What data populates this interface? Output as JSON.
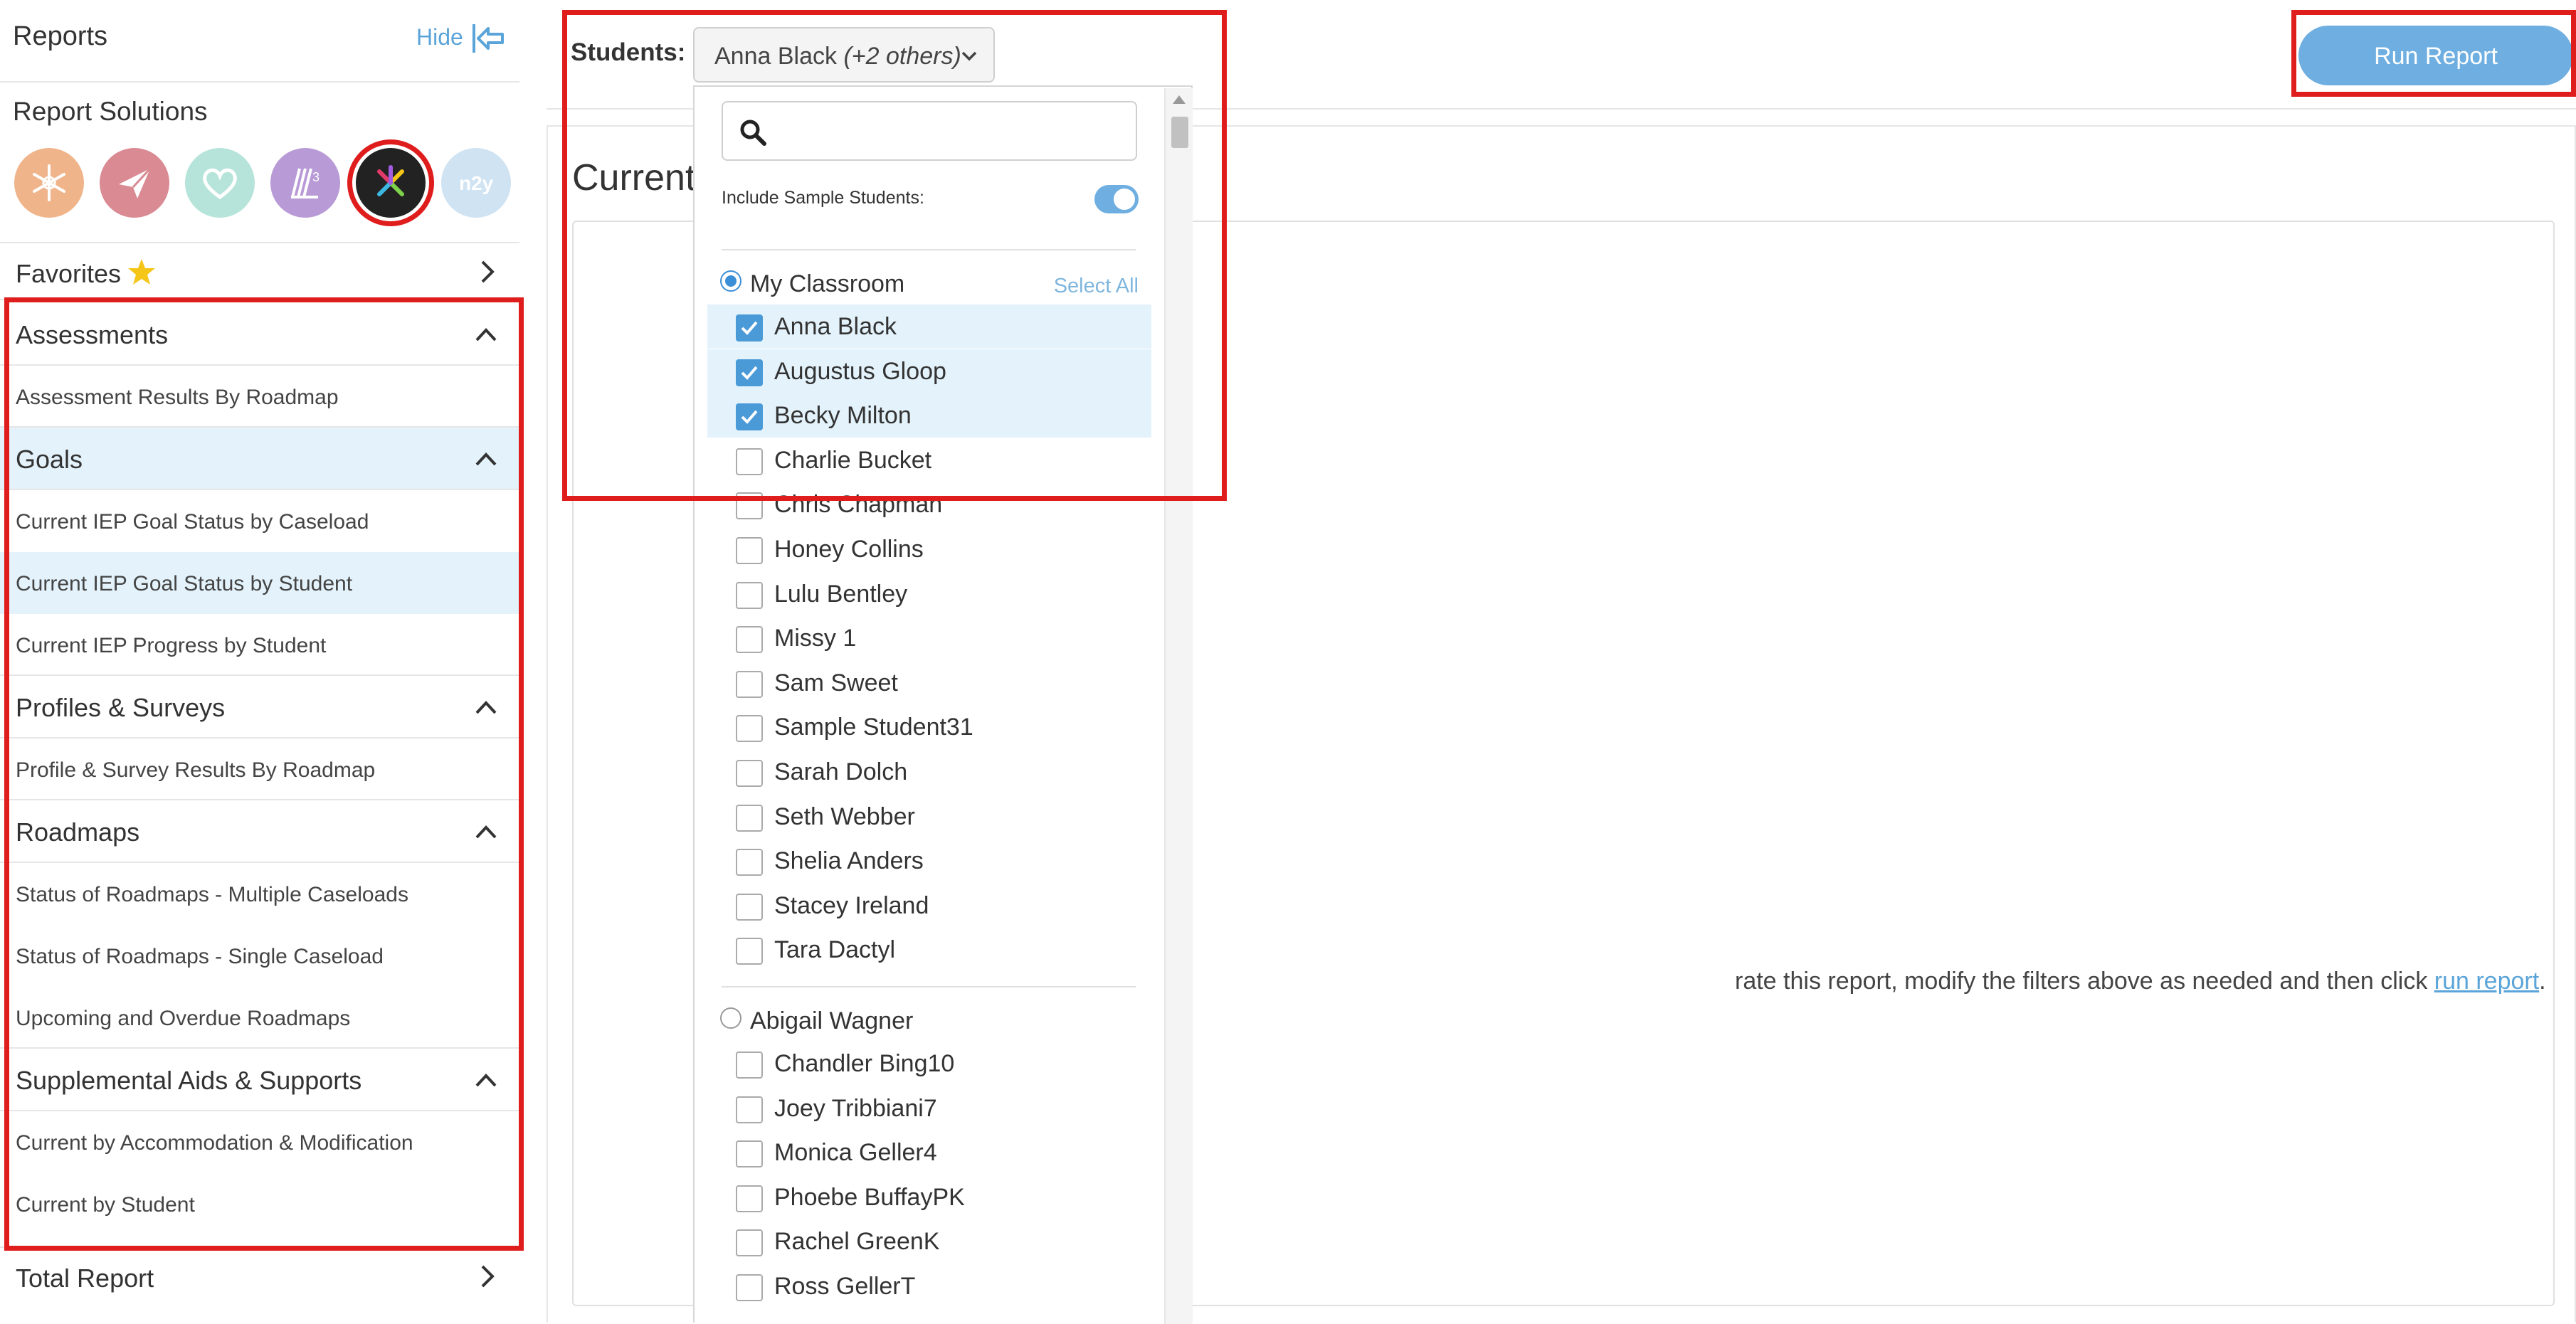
{
  "sidebar": {
    "title": "Reports",
    "hide_label": "Hide",
    "solutions_title": "Report Solutions",
    "solutions": [
      {
        "icon": "snowflake-icon",
        "color": "#f0b48a"
      },
      {
        "icon": "paper-plane-icon",
        "color": "#d98a92"
      },
      {
        "icon": "heart-icon",
        "color": "#b7e4da"
      },
      {
        "icon": "l3-logo-icon",
        "color": "#b89ad6"
      },
      {
        "icon": "colorful-x-icon",
        "color": "#222222",
        "selected": true
      },
      {
        "icon": "n2y-logo-icon",
        "color": "#cfe3f2"
      }
    ],
    "favorites_label": "Favorites",
    "categories": [
      {
        "label": "Assessments",
        "items": [
          "Assessment Results By Roadmap"
        ]
      },
      {
        "label": "Goals",
        "items": [
          "Current IEP Goal Status by Caseload",
          "Current IEP Goal Status by Student",
          "Current IEP Progress by Student"
        ]
      },
      {
        "label": "Profiles & Surveys",
        "items": [
          "Profile & Survey Results By Roadmap"
        ]
      },
      {
        "label": "Roadmaps",
        "items": [
          "Status of Roadmaps - Multiple Caseloads",
          "Status of Roadmaps - Single Caseload",
          "Upcoming and Overdue Roadmaps"
        ]
      },
      {
        "label": "Supplemental Aids & Supports",
        "items": [
          "Current by Accommodation & Modification",
          "Current by Student"
        ]
      }
    ],
    "total_label": "Total Report"
  },
  "main": {
    "students_label": "Students:",
    "selected_student": "Anna Black",
    "others_text": "(+2 others)",
    "run_button": "Run Report",
    "page_title": "Current",
    "instruction_prefix": "rate this report, modify the filters above as needed and then click ",
    "instruction_link": "run report",
    "instruction_suffix": "."
  },
  "dropdown": {
    "include_sample_label": "Include Sample Students:",
    "include_sample_on": true,
    "select_all_label": "Select All",
    "groups": [
      {
        "name": "My Classroom",
        "selected": true,
        "students": [
          {
            "name": "Anna Black",
            "checked": true
          },
          {
            "name": "Augustus Gloop",
            "checked": true
          },
          {
            "name": "Becky Milton",
            "checked": true
          },
          {
            "name": "Charlie Bucket",
            "checked": false
          },
          {
            "name": "Chris Chapman",
            "checked": false
          },
          {
            "name": "Honey Collins",
            "checked": false
          },
          {
            "name": "Lulu Bentley",
            "checked": false
          },
          {
            "name": "Missy 1",
            "checked": false
          },
          {
            "name": "Sam Sweet",
            "checked": false
          },
          {
            "name": "Sample Student31",
            "checked": false
          },
          {
            "name": "Sarah Dolch",
            "checked": false
          },
          {
            "name": "Seth Webber",
            "checked": false
          },
          {
            "name": "Shelia Anders",
            "checked": false
          },
          {
            "name": "Stacey Ireland",
            "checked": false
          },
          {
            "name": "Tara Dactyl",
            "checked": false
          }
        ]
      },
      {
        "name": "Abigail Wagner",
        "selected": false,
        "students": [
          {
            "name": "Chandler Bing10",
            "checked": false
          },
          {
            "name": "Joey Tribbiani7",
            "checked": false
          },
          {
            "name": "Monica Geller4",
            "checked": false
          },
          {
            "name": "Phoebe BuffayPK",
            "checked": false
          },
          {
            "name": "Rachel GreenK",
            "checked": false
          },
          {
            "name": "Ross GellerT",
            "checked": false
          }
        ]
      }
    ]
  },
  "colors": {
    "accent": "#5aa4d9",
    "button": "#6eaee0",
    "highlight": "#e3f2fb",
    "annotation": "#e01d1d"
  }
}
